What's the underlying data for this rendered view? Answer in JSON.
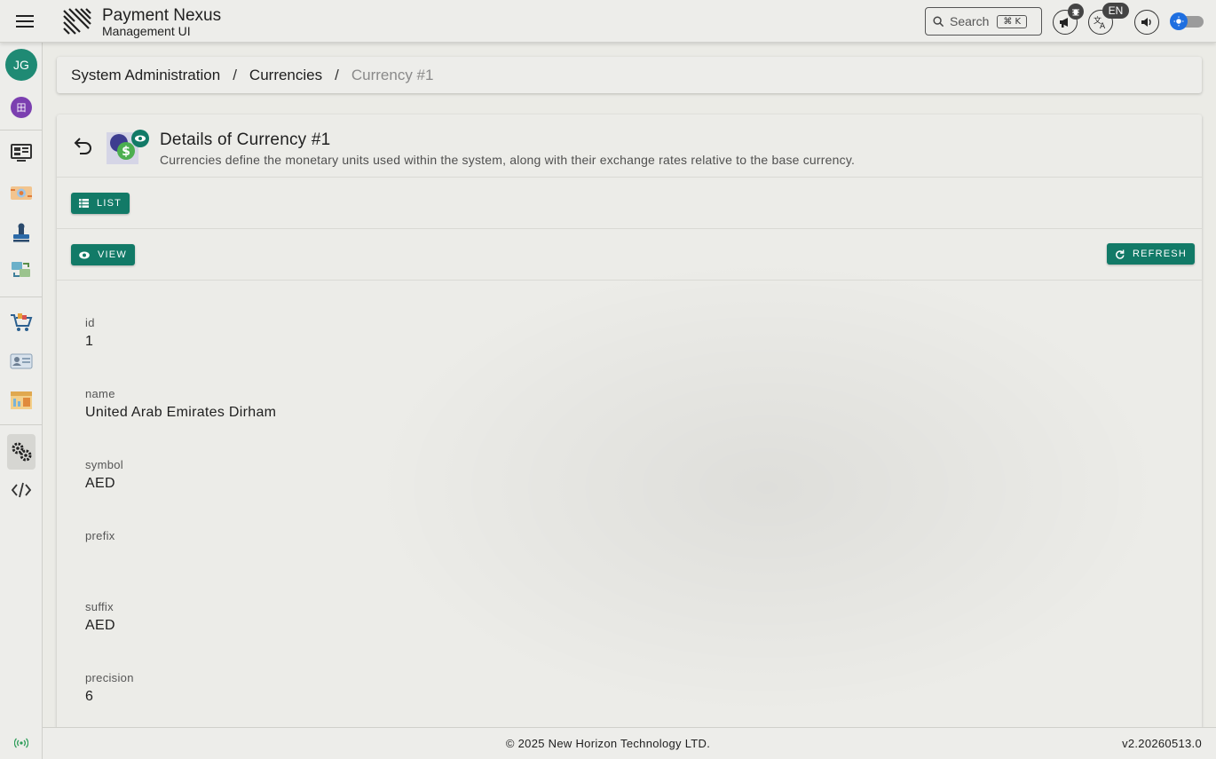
{
  "app": {
    "brand_title": "Payment Nexus",
    "brand_subtitle": "Management UI"
  },
  "topbar": {
    "search_label": "Search",
    "search_shortcut": "⌘ K",
    "language": "EN"
  },
  "sidebar": {
    "avatar_initials": "JG",
    "items": [
      {
        "icon": "org-icon"
      },
      {
        "icon": "monitor-icon"
      },
      {
        "icon": "payment-gateway-icon"
      },
      {
        "icon": "stamp-icon"
      },
      {
        "icon": "transfer-icon"
      },
      {
        "icon": "cart-icon"
      },
      {
        "icon": "id-card-icon"
      },
      {
        "icon": "reports-icon"
      },
      {
        "icon": "settings-icon"
      },
      {
        "icon": "code-icon"
      }
    ]
  },
  "breadcrumb": {
    "items": [
      "System Administration",
      "Currencies"
    ],
    "current": "Currency #1",
    "separator": "/"
  },
  "page": {
    "title": "Details of Currency #1",
    "description": "Currencies define the monetary units used within the system, along with their exchange rates relative to the base currency.",
    "list_button": "LIST",
    "view_button": "VIEW",
    "refresh_button": "REFRESH"
  },
  "fields": [
    {
      "label": "id",
      "value": "1"
    },
    {
      "label": "name",
      "value": "United Arab Emirates Dirham"
    },
    {
      "label": "symbol",
      "value": "AED"
    },
    {
      "label": "prefix",
      "value": ""
    },
    {
      "label": "suffix",
      "value": "AED"
    },
    {
      "label": "precision",
      "value": "6"
    }
  ],
  "footer": {
    "copyright": "© 2025 New Horizon Technology LTD.",
    "version": "v2.20260513.0"
  },
  "colors": {
    "accent": "#127a67",
    "avatar": "#1f8a74",
    "toggle": "#1f6fe0"
  }
}
